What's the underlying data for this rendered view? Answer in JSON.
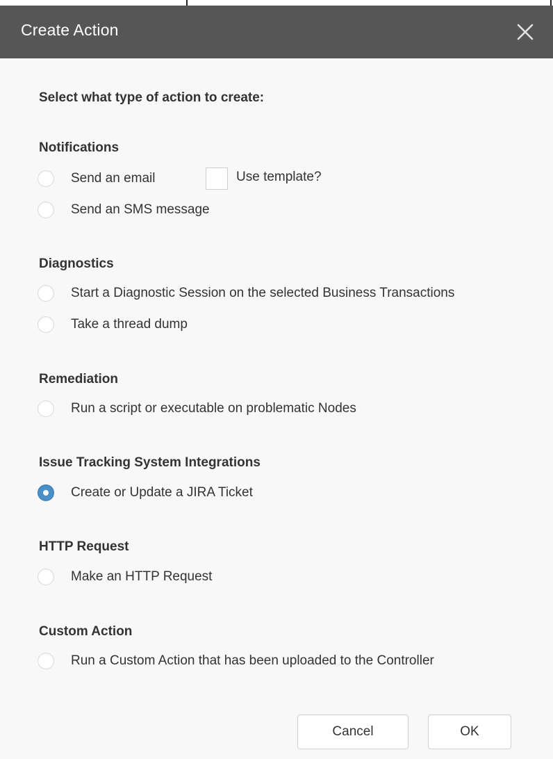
{
  "dialog": {
    "title": "Create Action",
    "close_icon": "close-icon",
    "prompt": "Select what type of action to create:"
  },
  "sections": {
    "notifications": {
      "title": "Notifications",
      "options": [
        {
          "label": "Send an email",
          "selected": false
        },
        {
          "label": "Send an SMS message",
          "selected": false
        }
      ],
      "use_template_label": "Use template?",
      "use_template_checked": false
    },
    "diagnostics": {
      "title": "Diagnostics",
      "options": [
        {
          "label": "Start a Diagnostic Session on the selected Business Transactions",
          "selected": false
        },
        {
          "label": "Take a thread dump",
          "selected": false
        }
      ]
    },
    "remediation": {
      "title": "Remediation",
      "options": [
        {
          "label": "Run a script or executable on problematic Nodes",
          "selected": false
        }
      ]
    },
    "issue_tracking": {
      "title": "Issue Tracking System Integrations",
      "options": [
        {
          "label": "Create or Update a JIRA Ticket",
          "selected": true
        }
      ]
    },
    "http_request": {
      "title": "HTTP Request",
      "options": [
        {
          "label": "Make an HTTP Request",
          "selected": false
        }
      ]
    },
    "custom_action": {
      "title": "Custom Action",
      "options": [
        {
          "label": "Run a Custom Action that has been uploaded to the Controller",
          "selected": false
        }
      ]
    }
  },
  "buttons": {
    "cancel_label": "Cancel",
    "ok_label": "OK"
  },
  "colors": {
    "titlebar": "#565656",
    "radio_selected": "#4a90c8",
    "background": "#f8f8f8"
  }
}
